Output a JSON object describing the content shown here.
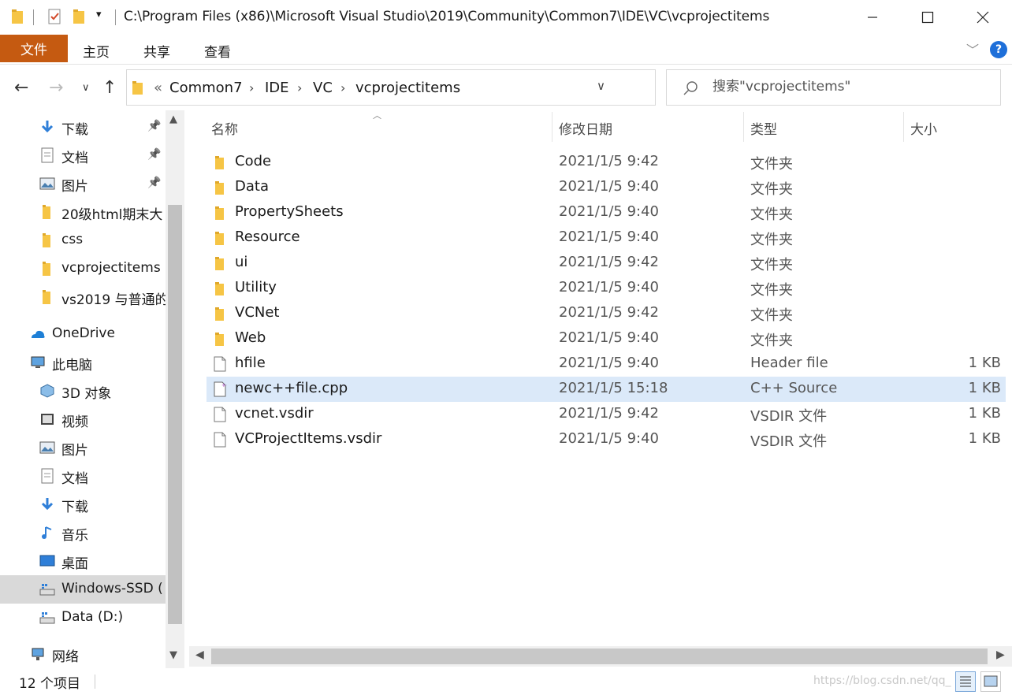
{
  "window": {
    "path": "C:\\Program Files (x86)\\Microsoft Visual Studio\\2019\\Community\\Common7\\IDE\\VC\\vcprojectitems",
    "minimize_icon": "minimize-icon",
    "maximize_icon": "maximize-icon",
    "close_icon": "close-icon"
  },
  "ribbon": {
    "file_tab": "文件",
    "tabs": [
      "主页",
      "共享",
      "查看"
    ],
    "help": "?"
  },
  "navigation": {
    "breadcrumb_prefix": "«",
    "breadcrumb": [
      "Common7",
      "IDE",
      "VC",
      "vcprojectitems"
    ],
    "search_placeholder": "搜索\"vcprojectitems\""
  },
  "nav_pane": {
    "items": [
      {
        "label": "下载",
        "icon": "download-icon",
        "pinned": true
      },
      {
        "label": "文档",
        "icon": "document-icon",
        "pinned": true
      },
      {
        "label": "图片",
        "icon": "picture-icon",
        "pinned": true
      },
      {
        "label": "20级html期末大",
        "icon": "folder-icon"
      },
      {
        "label": "css",
        "icon": "folder-icon"
      },
      {
        "label": "vcprojectitems",
        "icon": "folder-icon"
      },
      {
        "label": "vs2019  与普通的",
        "icon": "folder-icon"
      },
      {
        "label": "OneDrive",
        "icon": "onedrive-icon"
      },
      {
        "label": "此电脑",
        "icon": "computer-icon"
      },
      {
        "label": "3D 对象",
        "icon": "3d-objects-icon"
      },
      {
        "label": "视频",
        "icon": "video-icon"
      },
      {
        "label": "图片",
        "icon": "picture-icon"
      },
      {
        "label": "文档",
        "icon": "document-icon"
      },
      {
        "label": "下载",
        "icon": "download-icon"
      },
      {
        "label": "音乐",
        "icon": "music-icon"
      },
      {
        "label": "桌面",
        "icon": "desktop-icon"
      },
      {
        "label": "Windows-SSD (",
        "icon": "drive-icon",
        "selected": true
      },
      {
        "label": "Data (D:)",
        "icon": "drive-icon"
      },
      {
        "label": "网络",
        "icon": "network-icon"
      }
    ]
  },
  "columns": {
    "name": "名称",
    "modified": "修改日期",
    "type": "类型",
    "size": "大小"
  },
  "files": [
    {
      "name": "Code",
      "date": "2021/1/5 9:42",
      "type": "文件夹",
      "size": "",
      "kind": "folder"
    },
    {
      "name": "Data",
      "date": "2021/1/5 9:40",
      "type": "文件夹",
      "size": "",
      "kind": "folder"
    },
    {
      "name": "PropertySheets",
      "date": "2021/1/5 9:40",
      "type": "文件夹",
      "size": "",
      "kind": "folder"
    },
    {
      "name": "Resource",
      "date": "2021/1/5 9:40",
      "type": "文件夹",
      "size": "",
      "kind": "folder"
    },
    {
      "name": "ui",
      "date": "2021/1/5 9:42",
      "type": "文件夹",
      "size": "",
      "kind": "folder"
    },
    {
      "name": "Utility",
      "date": "2021/1/5 9:40",
      "type": "文件夹",
      "size": "",
      "kind": "folder"
    },
    {
      "name": "VCNet",
      "date": "2021/1/5 9:42",
      "type": "文件夹",
      "size": "",
      "kind": "folder"
    },
    {
      "name": "Web",
      "date": "2021/1/5 9:40",
      "type": "文件夹",
      "size": "",
      "kind": "folder"
    },
    {
      "name": "hfile",
      "date": "2021/1/5 9:40",
      "type": "Header file",
      "size": "1 KB",
      "kind": "file"
    },
    {
      "name": "newc++file.cpp",
      "date": "2021/1/5 15:18",
      "type": "C++ Source",
      "size": "1 KB",
      "kind": "cpp",
      "selected": true
    },
    {
      "name": "vcnet.vsdir",
      "date": "2021/1/5 9:42",
      "type": "VSDIR 文件",
      "size": "1 KB",
      "kind": "file"
    },
    {
      "name": "VCProjectItems.vsdir",
      "date": "2021/1/5 9:40",
      "type": "VSDIR 文件",
      "size": "1 KB",
      "kind": "file"
    }
  ],
  "status": {
    "count": "12 个项目",
    "watermark": "https://blog.csdn.net/qq_"
  },
  "colors": {
    "file_tab": "#c55a11",
    "selection": "#dbe9f9",
    "folder": "#f6c545",
    "accent": "#1e6fd9"
  }
}
